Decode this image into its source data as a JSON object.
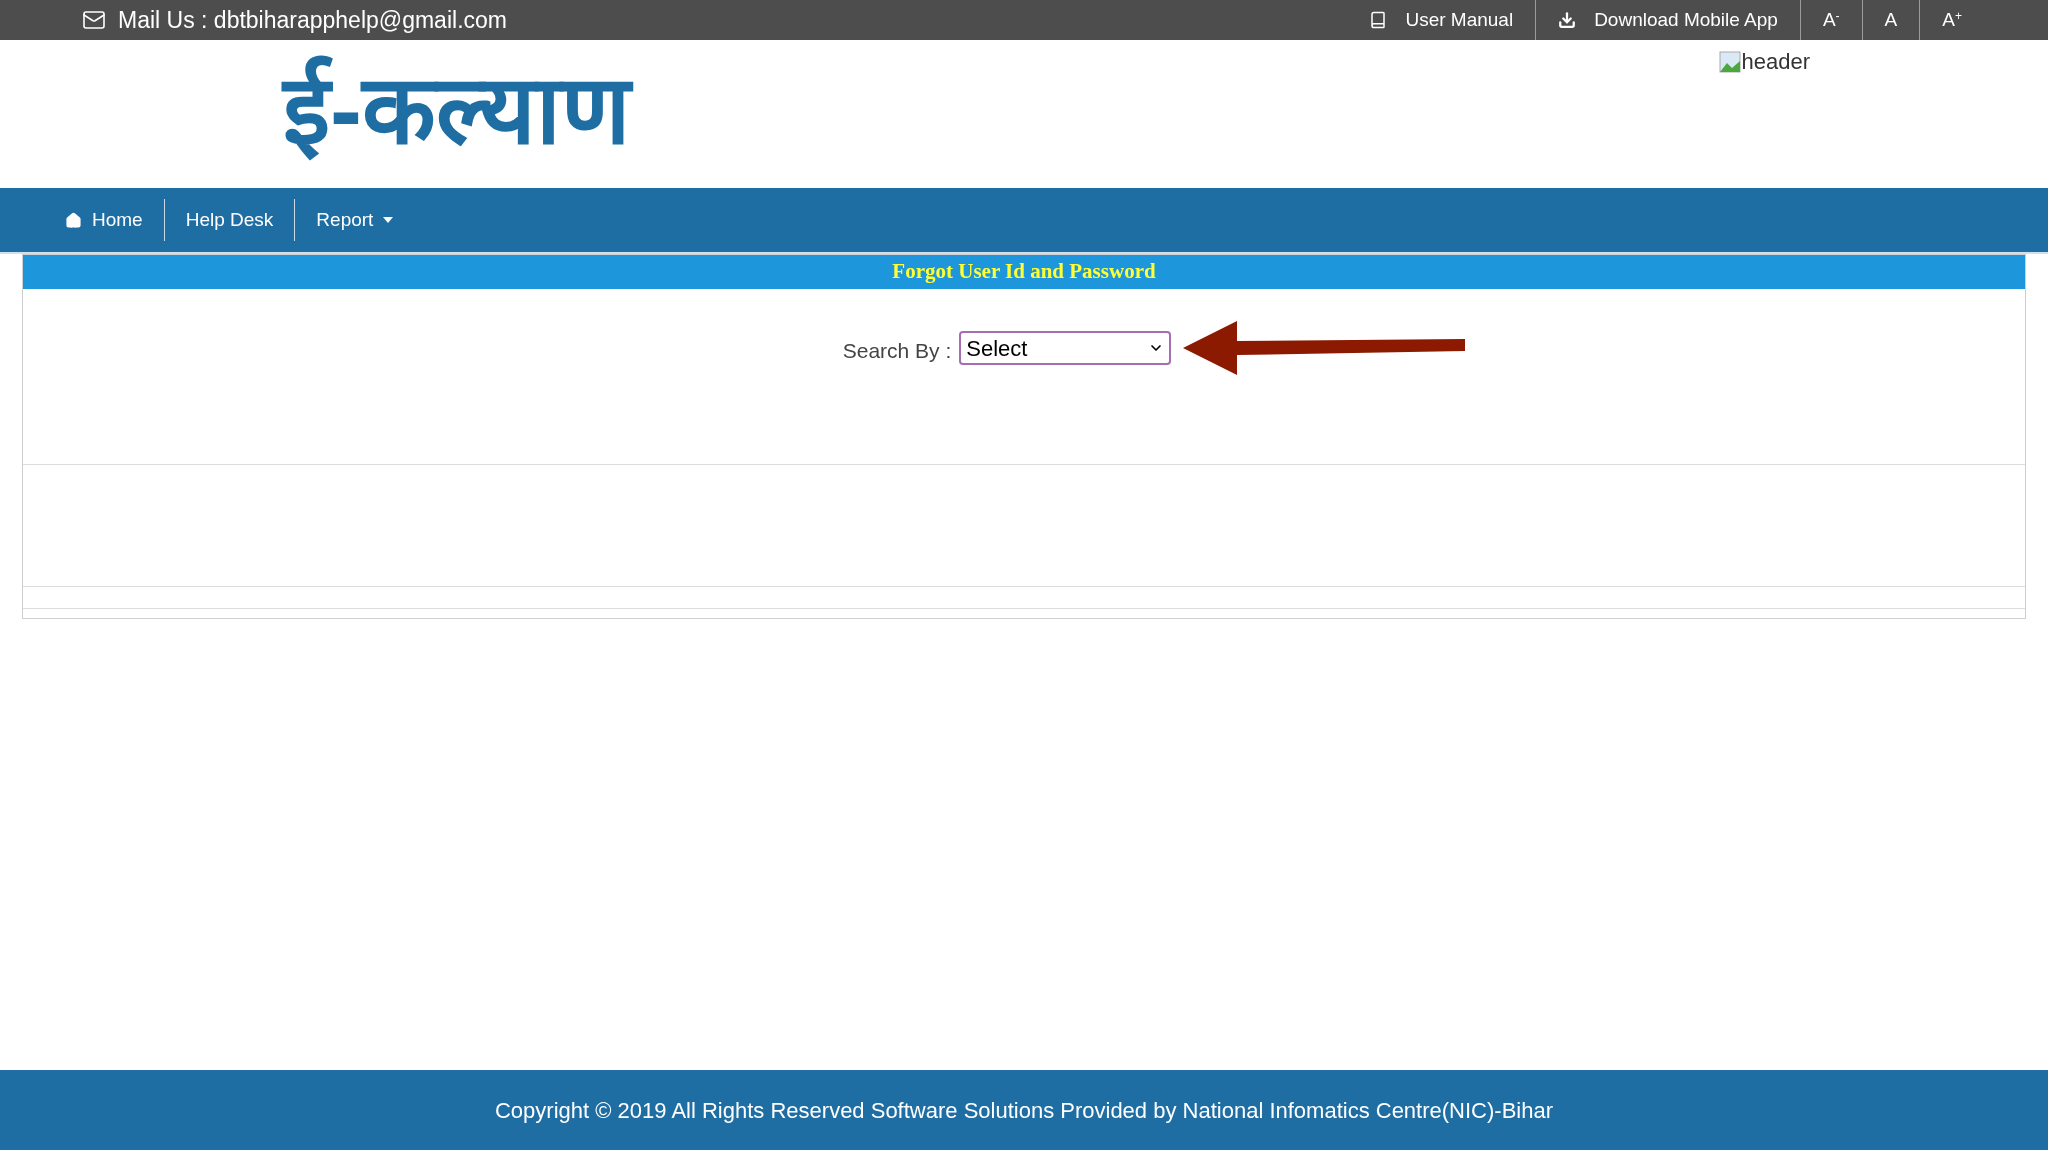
{
  "top_bar": {
    "mail": "Mail Us : dbtbiharapphelp@gmail.com",
    "links": [
      {
        "label": "User Manual",
        "kind": "book"
      },
      {
        "label": "Download Mobile App",
        "kind": "download"
      }
    ],
    "font_sizes": [
      {
        "label": "A",
        "sup": "-"
      },
      {
        "label": "A"
      },
      {
        "label": "A",
        "sup": "+"
      }
    ]
  },
  "header": {
    "logo": "ई-कल्याण",
    "image_alt": "header"
  },
  "nav": [
    {
      "label": "Home",
      "kind": "home"
    },
    {
      "label": "Help Desk",
      "kind": "plain"
    },
    {
      "label": "Report",
      "kind": "dropdown"
    }
  ],
  "form": {
    "title": "Forgot User Id and Password",
    "search_label": "Search By :",
    "select_value": "Select"
  },
  "footer": "Copyright © 2019 All Rights Reserved Software Solutions Provided by National Infomatics Centre(NIC)-Bihar"
}
